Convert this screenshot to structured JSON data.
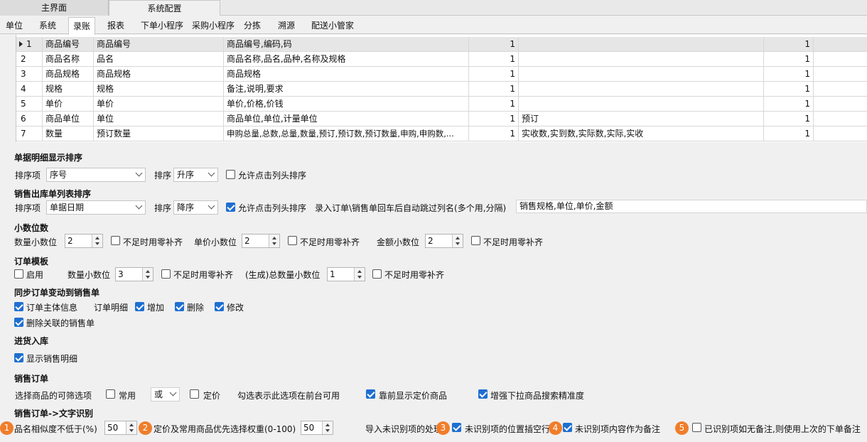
{
  "top_tabs": [
    {
      "label": "主界面"
    },
    {
      "label": "系统配置"
    }
  ],
  "sub_tabs": [
    "单位",
    "系统",
    "录账",
    "报表",
    "下单小程序",
    "采购小程序",
    "分拣",
    "溯源",
    "配送小管家"
  ],
  "grid_rows": [
    {
      "no": "1",
      "field": "商品编号",
      "name": "商品编号",
      "aliases": "商品编号,编码,码",
      "v1": "1",
      "extra": "",
      "v2": "1"
    },
    {
      "no": "2",
      "field": "商品名称",
      "name": "品名",
      "aliases": "商品名称,品名,品种,名称及规格",
      "v1": "1",
      "extra": "",
      "v2": "1"
    },
    {
      "no": "3",
      "field": "商品规格",
      "name": "商品规格",
      "aliases": "商品规格",
      "v1": "1",
      "extra": "",
      "v2": "1"
    },
    {
      "no": "4",
      "field": "规格",
      "name": "规格",
      "aliases": "备注,说明,要求",
      "v1": "1",
      "extra": "",
      "v2": "1"
    },
    {
      "no": "5",
      "field": "单价",
      "name": "单价",
      "aliases": "单价,价格,价钱",
      "v1": "1",
      "extra": "",
      "v2": "1"
    },
    {
      "no": "6",
      "field": "商品单位",
      "name": "单位",
      "aliases": "商品单位,单位,计量单位",
      "v1": "1",
      "extra": "预订",
      "v2": "1"
    },
    {
      "no": "7",
      "field": "数量",
      "name": "预订数量",
      "aliases": "申购总量,总数,总量,数量,预订,预订数,预订数量,申购,申购数,...",
      "v1": "1",
      "extra": "实收数,实到数,实际数,实际,实收",
      "v2": "1"
    }
  ],
  "detail_sort": {
    "title": "单据明细显示排序",
    "sort_item_label": "排序项",
    "sort_item_value": "序号",
    "order_label": "排序",
    "order_value": "升序",
    "allow_label": "允许点击列头排序",
    "allow_checked": false
  },
  "out_sort": {
    "title": "销售出库单列表排序",
    "sort_item_label": "排序项",
    "sort_item_value": "单据日期",
    "order_label": "排序",
    "order_value": "降序",
    "allow_label": "允许点击列头排序",
    "allow_checked": true,
    "skip_label": "录入订单\\销售单回车后自动跳过列名(多个用,分隔)",
    "skip_value": "销售规格,单位,单价,金额"
  },
  "decimals": {
    "title": "小数位数",
    "qty_label": "数量小数位",
    "qty_value": "2",
    "qty_pad": "不足时用零补齐",
    "price_label": "单价小数位",
    "price_value": "2",
    "price_pad": "不足时用零补齐",
    "amount_label": "金额小数位",
    "amount_value": "2",
    "amount_pad": "不足时用零补齐"
  },
  "order_tpl": {
    "title": "订单模板",
    "enable_label": "启用",
    "qty_label": "数量小数位",
    "qty_value": "3",
    "qty_pad": "不足时用零补齐",
    "gen_label": "(生成)总数量小数位",
    "gen_value": "1",
    "gen_pad": "不足时用零补齐"
  },
  "sync": {
    "title": "同步订单变动到销售单",
    "main_label": "订单主体信息",
    "detail_label": "订单明细",
    "add_label": "增加",
    "del_label": "删除",
    "mod_label": "修改",
    "del_linked_label": "删除关联的销售单"
  },
  "purchase": {
    "title": "进货入库",
    "show_label": "显示销售明细"
  },
  "sales_order": {
    "title": "销售订单",
    "filter_label": "选择商品的可筛选项",
    "common_label": "常用",
    "or_value": "或",
    "price_label": "定价",
    "hint": "勾选表示此选项在前台可用",
    "front_label": "靠前显示定价商品",
    "enhance_label": "增强下拉商品搜索精准度"
  },
  "ocr": {
    "title": "销售订单->文字识别",
    "b1": "1",
    "sim_label": "品名相似度不低于(%)",
    "sim_value": "50",
    "b2": "2",
    "weight_label": "定价及常用商品优先选择权重(0-100)",
    "weight_value": "50",
    "unrec_label": "导入未识别项的处理",
    "b3": "3",
    "blank_label": "未识别项的位置插空行",
    "b4": "4",
    "remark_label": "未识别项内容作为备注",
    "b5": "5",
    "last_label": "已识别项如无备注,则使用上次的下单备注"
  },
  "colors": {
    "accent": "#1e6fd2",
    "badge": "#f07d2a"
  }
}
